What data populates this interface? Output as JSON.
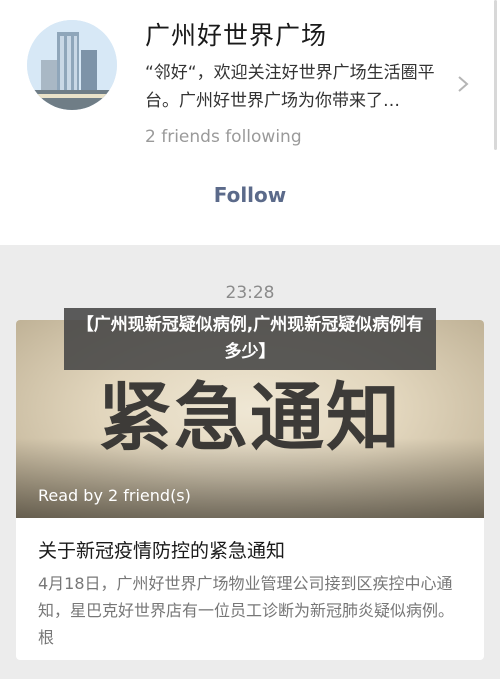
{
  "profile": {
    "name": "广州好世界广场",
    "intro": "“邻好“，欢迎关注好世界广场生活圈平台。广州好世界广场为你带来了…",
    "friends_following": "2 friends following",
    "follow_label": "Follow",
    "avatar_icon": "building-photo-icon",
    "chevron_icon": "chevron-right-icon"
  },
  "timestamp": "23:28",
  "overlay": {
    "text": "【广州现新冠疑似病例,广州现新冠疑似病例有多少】"
  },
  "article": {
    "cover_text": "紧急通知",
    "read_by": "Read by 2 friend(s)",
    "title": "关于新冠疫情防控的紧急通知",
    "digest": "4月18日，广州好世界广场物业管理公司接到区疾控中心通知，星巴克好世界店有一位员工诊断为新冠肺炎疑似病例。根"
  },
  "colors": {
    "follow": "#5b6a8a",
    "background": "#ececec",
    "overlay": "#464646"
  }
}
